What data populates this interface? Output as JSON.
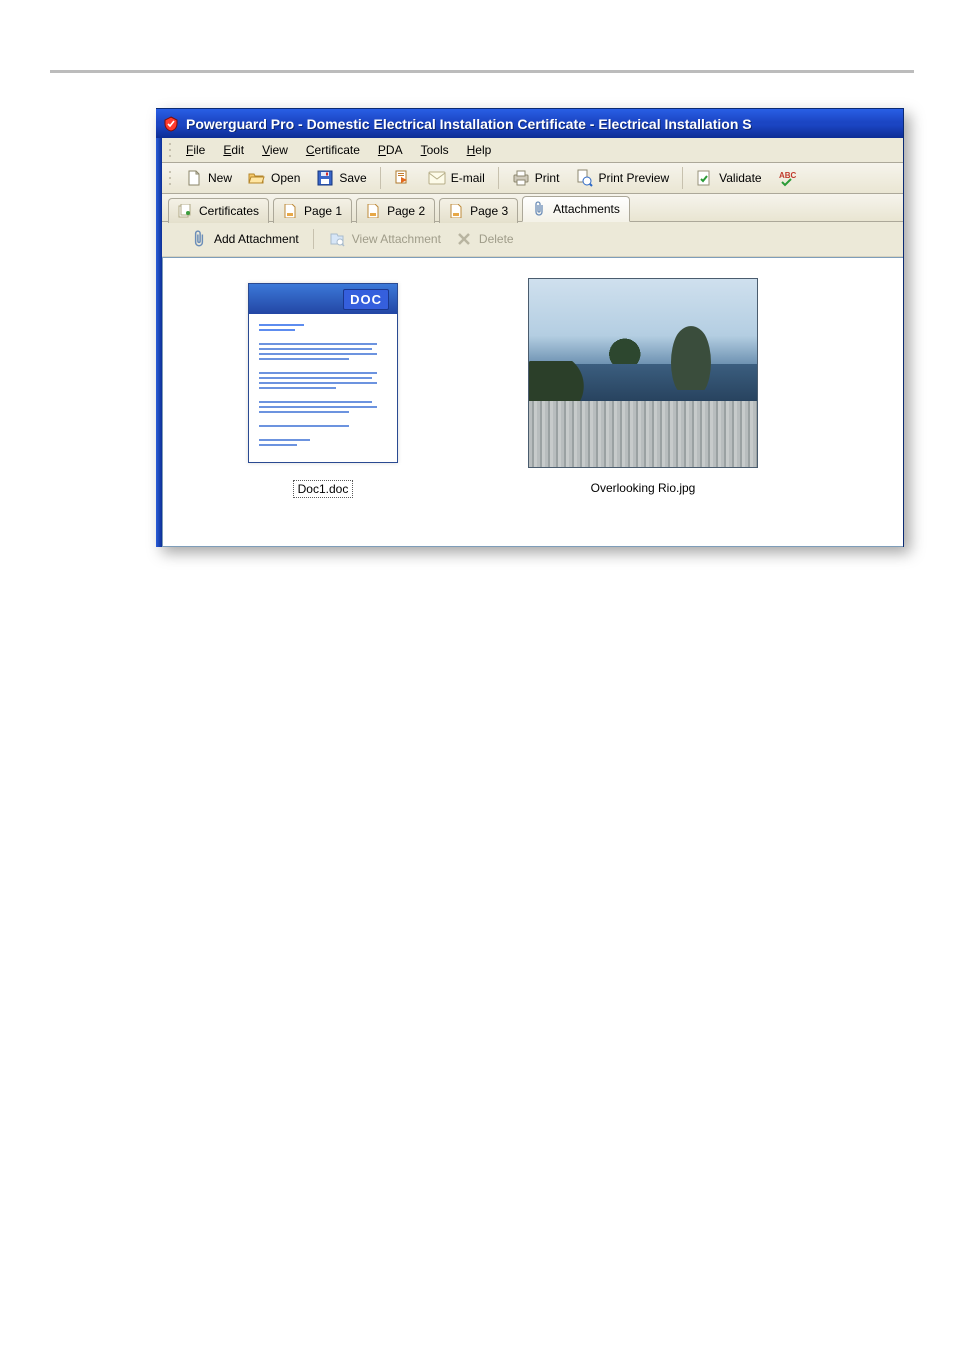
{
  "titlebar": {
    "title": "Powerguard Pro - Domestic Electrical Installation Certificate - Electrical Installation S"
  },
  "menu": {
    "file": "File",
    "edit": "Edit",
    "view": "View",
    "certificate": "Certificate",
    "pda": "PDA",
    "tools": "Tools",
    "help": "Help"
  },
  "toolbar": {
    "new": "New",
    "open": "Open",
    "save": "Save",
    "email": "E-mail",
    "print": "Print",
    "print_preview": "Print Preview",
    "validate": "Validate"
  },
  "tabs": {
    "certificates": "Certificates",
    "page1": "Page 1",
    "page2": "Page 2",
    "page3": "Page 3",
    "attachments": "Attachments"
  },
  "attachbar": {
    "add": "Add Attachment",
    "view": "View Attachment",
    "delete": "Delete"
  },
  "attachments": [
    {
      "filename": "Doc1.doc",
      "selected": true,
      "kind": "doc"
    },
    {
      "filename": "Overlooking Rio.jpg",
      "selected": false,
      "kind": "image"
    }
  ],
  "doc_badge": "DOC"
}
